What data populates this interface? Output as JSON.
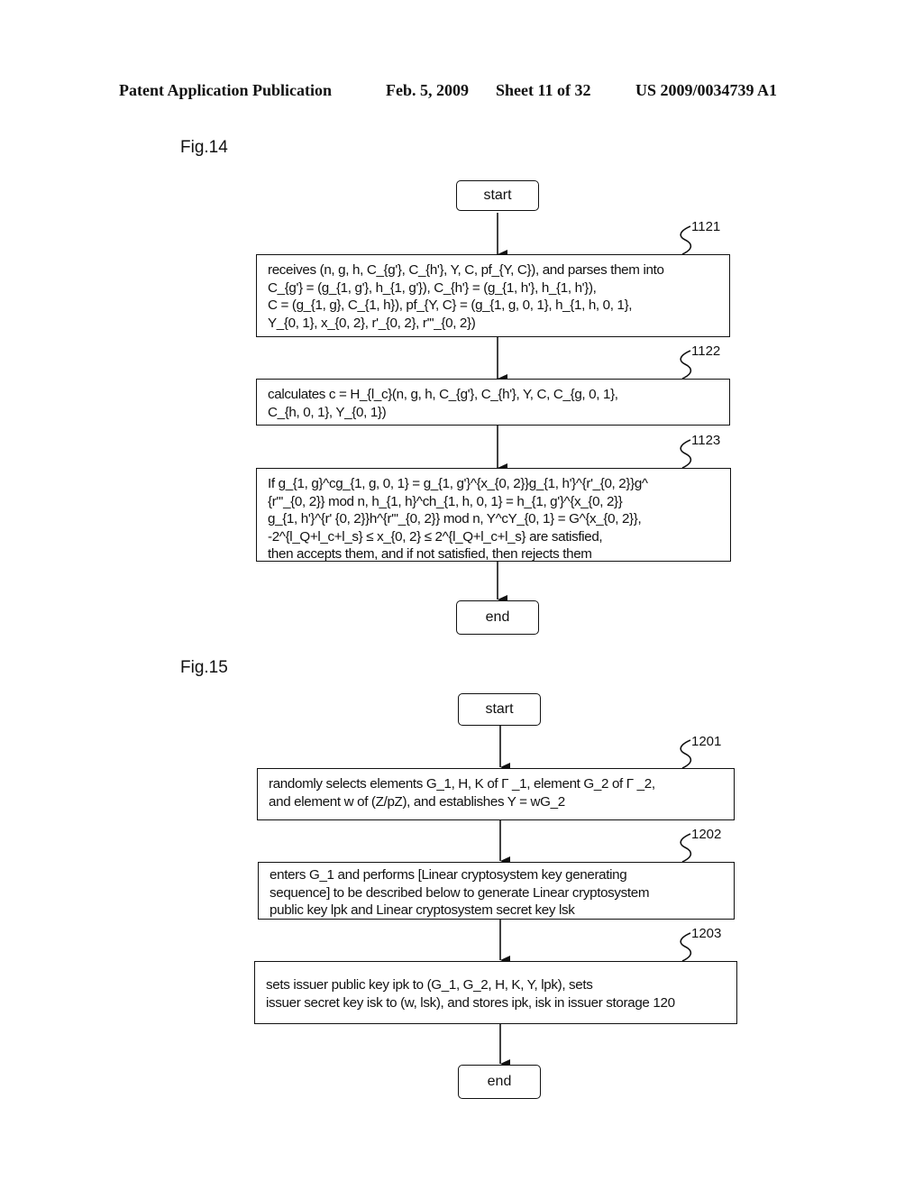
{
  "header": {
    "publication": "Patent Application Publication",
    "date": "Feb. 5, 2009",
    "sheet": "Sheet 11 of 32",
    "number": "US 2009/0034739 A1"
  },
  "fig14": {
    "label": "Fig.14",
    "start": "start",
    "end": "end",
    "steps": [
      {
        "ref": "1121",
        "lines": [
          "receives (n, g, h, C_{g'}, C_{h'}, Y, C, pf_{Y, C}), and parses them into",
          "C_{g'} = (g_{1, g'}, h_{1, g'}), C_{h'} = (g_{1, h'}, h_{1, h'}),",
          "C = (g_{1, g}, C_{1, h}), pf_{Y, C} = (g_{1, g, 0, 1}, h_{1, h, 0, 1},",
          "Y_{0, 1}, x_{0, 2}, r'_{0, 2}, r'''_{0, 2})"
        ]
      },
      {
        "ref": "1122",
        "lines": [
          "calculates c = H_{l_c}(n, g, h, C_{g'}, C_{h'}, Y, C, C_{g, 0, 1},",
          "C_{h, 0, 1}, Y_{0, 1})"
        ]
      },
      {
        "ref": "1123",
        "lines": [
          "If g_{1, g}^cg_{1, g, 0, 1} = g_{1, g'}^{x_{0, 2}}g_{1, h'}^{r'_{0, 2}}g^",
          "{r'''_{0, 2}} mod n, h_{1, h}^ch_{1, h, 0, 1} = h_{1, g'}^{x_{0, 2}}",
          "g_{1, h'}^{r' {0, 2}}h^{r'''_{0, 2}} mod n, Y^cY_{0, 1} = G^{x_{0, 2}},",
          "-2^{l_Q+l_c+l_s} ≤ x_{0, 2} ≤ 2^{l_Q+l_c+l_s} are satisfied,",
          "then accepts them, and if not satisfied, then rejects them"
        ]
      }
    ]
  },
  "fig15": {
    "label": "Fig.15",
    "start": "start",
    "end": "end",
    "steps": [
      {
        "ref": "1201",
        "lines": [
          "randomly selects elements G_1, H, K of  Γ _1, element G_2 of  Γ _2,",
          "and element w of (Z/pZ), and establishes Y = wG_2"
        ]
      },
      {
        "ref": "1202",
        "lines": [
          "enters G_1 and performs [Linear cryptosystem key generating",
          "sequence] to be described below to generate Linear cryptosystem",
          "public key lpk and Linear cryptosystem secret key lsk"
        ]
      },
      {
        "ref": "1203",
        "lines": [
          "sets issuer public key ipk to (G_1, G_2, H, K, Y, lpk), sets",
          "issuer secret key isk to (w, lsk), and stores ipk, isk in issuer storage 120"
        ]
      }
    ]
  }
}
